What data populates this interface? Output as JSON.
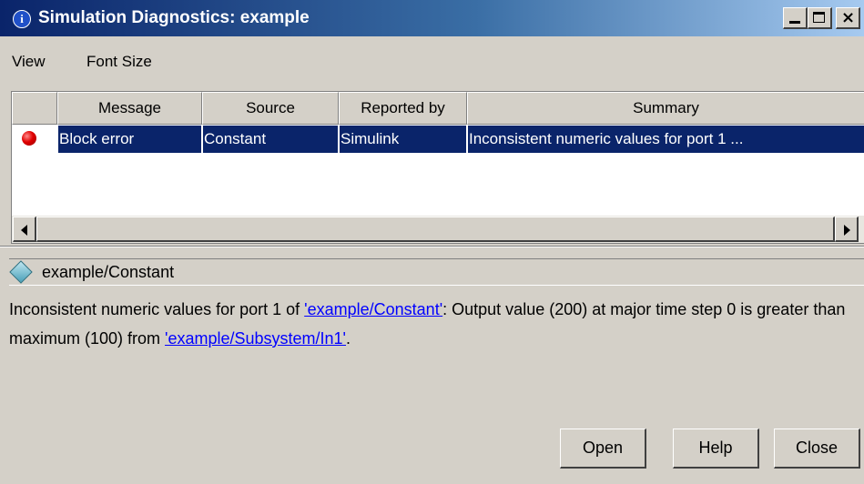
{
  "window": {
    "title": "Simulation Diagnostics: example",
    "info_icon": "info-icon",
    "controls": [
      "minimize",
      "maximize",
      "close"
    ]
  },
  "menu": {
    "items": [
      "View",
      "Font Size"
    ]
  },
  "table": {
    "headers": [
      "",
      "Message",
      "Source",
      "Reported by",
      "Summary"
    ],
    "rows": [
      {
        "icon": "error-icon",
        "message": "Block error",
        "source": "Constant",
        "reported_by": "Simulink",
        "summary": "Inconsistent numeric values for port 1 ..."
      }
    ],
    "selected_row": 0
  },
  "detail": {
    "path": "example/Constant",
    "message_part1": "Inconsistent numeric values for port 1 of ",
    "link1": "'example/Constant'",
    "message_part2": ": Output value (200) at major time step 0 is greater than maximum (100) from ",
    "link2": "'example/Subsystem/In1'",
    "message_part3": "."
  },
  "buttons": {
    "open": "Open",
    "help": "Help",
    "close": "Close"
  },
  "colors": {
    "selection": "#0a246a",
    "title_start": "#0a246a",
    "title_end": "#a6caf0",
    "link": "#0000ff",
    "error": "#e00000"
  }
}
